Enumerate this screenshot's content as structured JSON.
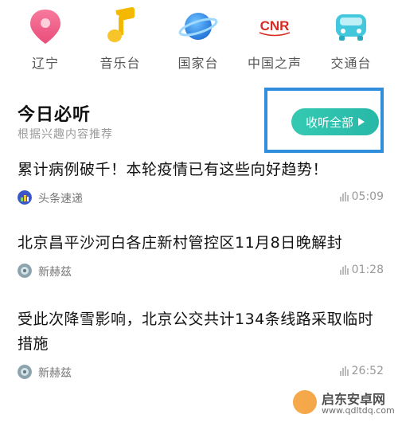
{
  "categories": [
    {
      "label": "辽宁",
      "icon": "location-pin-icon",
      "color": "#f0608a"
    },
    {
      "label": "音乐台",
      "icon": "music-note-icon",
      "color": "#f5b800"
    },
    {
      "label": "国家台",
      "icon": "planet-icon",
      "color": "#2e8ff0"
    },
    {
      "label": "中国之声",
      "icon": "cnr-logo-icon",
      "color": "#d62b22",
      "logo_text": "CNR"
    },
    {
      "label": "交通台",
      "icon": "car-icon",
      "color": "#3fc2d8"
    }
  ],
  "section": {
    "title": "今日必听",
    "subtitle": "根据兴趣内容推荐",
    "listen_all_label": "收听全部"
  },
  "news": [
    {
      "headline": "累计病例破千！本轮疫情已有这些向好趋势！",
      "source": "头条速递",
      "duration": "05:09"
    },
    {
      "headline": "北京昌平沙河白各庄新村管控区11月8日晚解封",
      "source": "新赫兹",
      "duration": "01:28"
    },
    {
      "headline": "受此次降雪影响，北京公交共计134条线路采取临时措施",
      "source": "新赫兹",
      "duration": "26:52"
    }
  ],
  "watermark": {
    "title": "启东安卓网",
    "url": "www.qdltdq.com"
  }
}
